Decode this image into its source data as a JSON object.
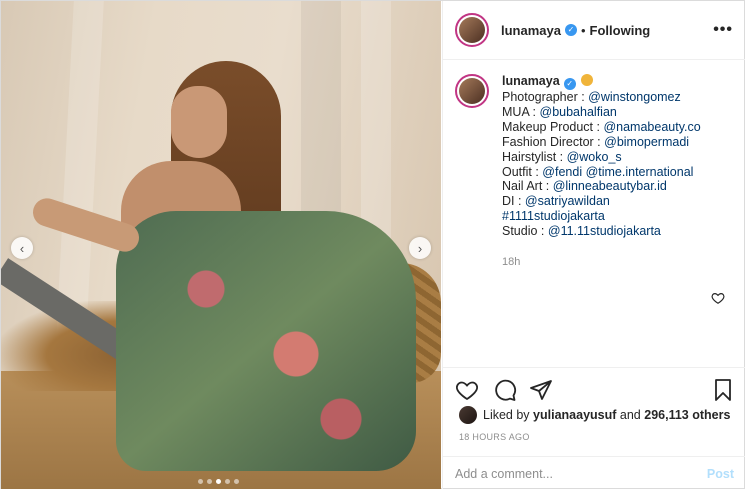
{
  "post": {
    "username": "lunamaya",
    "follow_separator": "•",
    "follow_status": "Following",
    "more_icon": "more-horizontal-icon",
    "caption": {
      "username": "lunamaya",
      "lines": [
        {
          "label": "Photographer : ",
          "value": "@winstongomez"
        },
        {
          "label": "MUA : ",
          "value": "@bubahalfian"
        },
        {
          "label": "Makeup Product : ",
          "value": "@namabeauty.co"
        },
        {
          "label": "Fashion Director : ",
          "value": "@bimopermadi"
        },
        {
          "label": "Hairstylist : ",
          "value": "@woko_s"
        },
        {
          "label": "Outfit : ",
          "value": "@fendi @time.international"
        },
        {
          "label": "Nail Art : ",
          "value": "@linneabeautybar.id"
        },
        {
          "label": "DI : ",
          "value": "@satriyawildan"
        },
        {
          "label": "",
          "value": "#1111studiojakarta"
        },
        {
          "label": "Studio : ",
          "value": "@11.11studiojakarta"
        }
      ],
      "time": "18h"
    },
    "likes": {
      "prefix": "Liked by ",
      "user": "yulianaayusuf",
      "middle": " and ",
      "count": "296,113 others"
    },
    "time_ago": "18 HOURS AGO",
    "comment": {
      "placeholder": "Add a comment...",
      "post_label": "Post"
    },
    "carousel": {
      "prev": "‹",
      "next": "›",
      "slide_count": 5,
      "active_slide": 2
    }
  },
  "colors": {
    "verified": "#3897f0",
    "link": "#00376b",
    "post_button_disabled": "#b2dffc",
    "story_ring": "#c13584"
  }
}
